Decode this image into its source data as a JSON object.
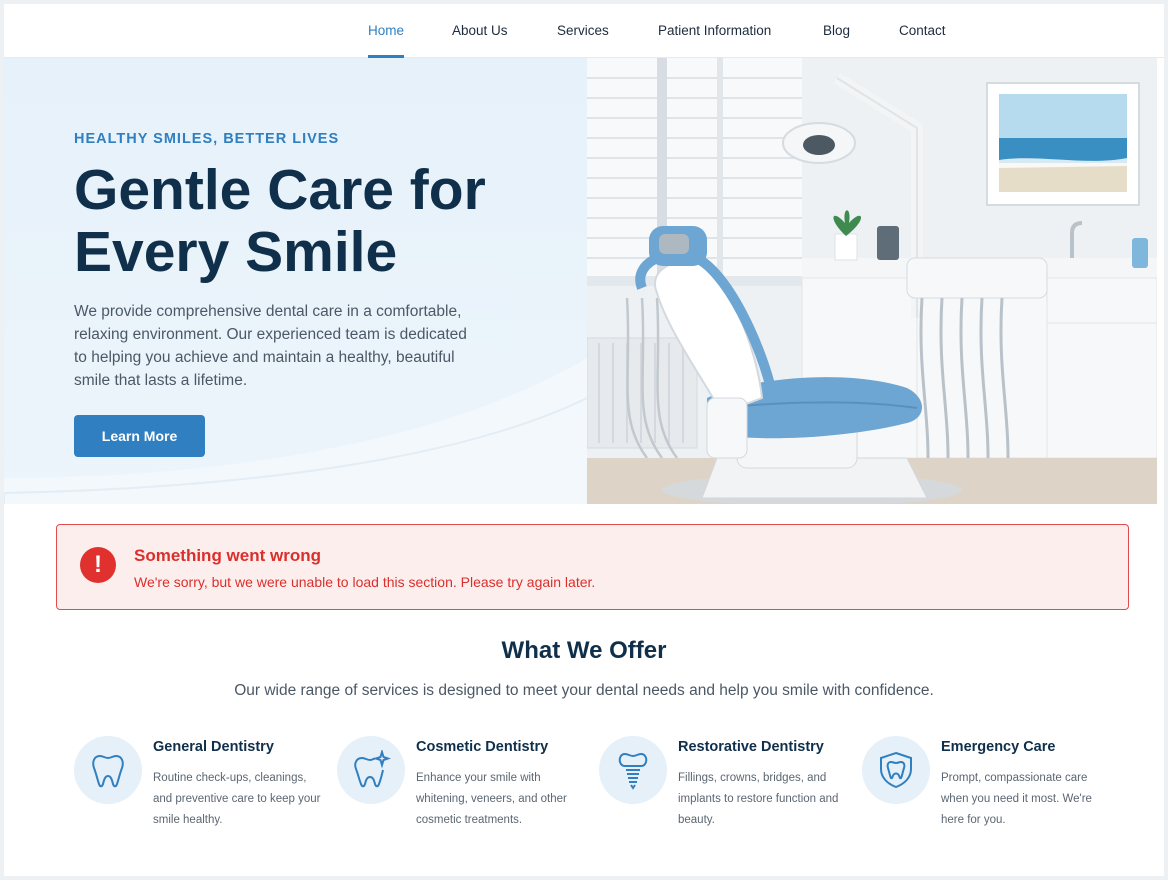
{
  "nav": {
    "items": [
      {
        "label": "Home",
        "active": true
      },
      {
        "label": "About Us"
      },
      {
        "label": "Services"
      },
      {
        "label": "Patient Information"
      },
      {
        "label": "Blog"
      },
      {
        "label": "Contact"
      }
    ]
  },
  "hero": {
    "eyebrow": "HEALTHY SMILES, BETTER LIVES",
    "headline": "Gentle Care for Every Smile",
    "body": "We provide comprehensive dental care in a comfortable, relaxing environment. Our experienced team is dedicated to helping you achieve and maintain a healthy, beautiful smile that lasts a lifetime.",
    "button_label": "Learn More"
  },
  "alert": {
    "icon": "exclamation-icon",
    "title": "Something went wrong",
    "message": "We're sorry, but we were unable to load this section. Please try again later."
  },
  "services": {
    "title": "What We Offer",
    "subtitle": "Our wide range of services is designed to meet your dental needs and help you smile with confidence.",
    "items": [
      {
        "title": "General Dentistry",
        "description": "Routine check-ups, cleanings, and preventive care to keep your smile healthy.",
        "icon": "tooth-icon"
      },
      {
        "title": "Cosmetic Dentistry",
        "description": "Enhance your smile with whitening, veneers, and other cosmetic treatments.",
        "icon": "sparkle-tooth-icon"
      },
      {
        "title": "Restorative Dentistry",
        "description": "Fillings, crowns, bridges, and implants to restore function and beauty.",
        "icon": "dental-implant-icon"
      },
      {
        "title": "Emergency Care",
        "description": "Prompt, compassionate care when you need it most. We're here for you.",
        "icon": "shield-tooth-icon"
      }
    ]
  },
  "colors": {
    "accent": "#2f7fc1",
    "heading": "#0f2f4a",
    "error": "#e0312f",
    "error_bg": "#fdeeee",
    "chair_blue": "#6da6d2"
  }
}
